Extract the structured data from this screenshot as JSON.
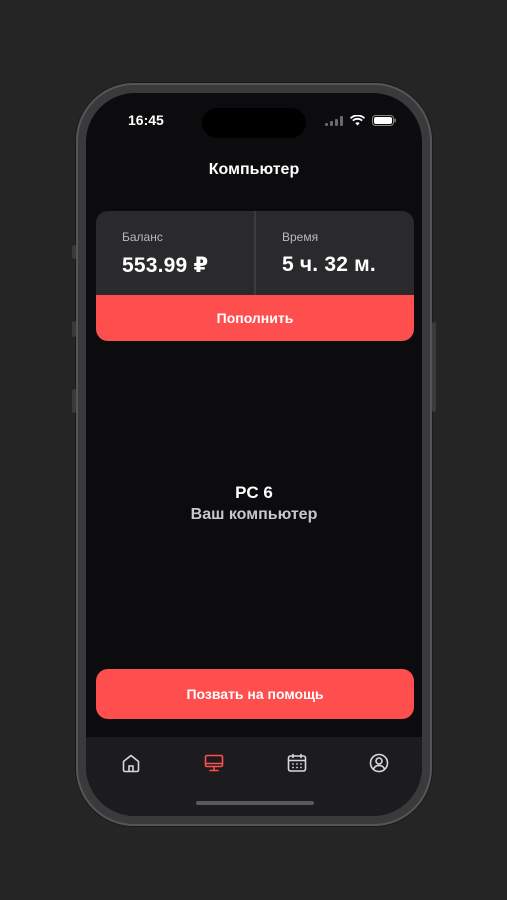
{
  "status_bar": {
    "time": "16:45"
  },
  "header": {
    "title": "Компьютер"
  },
  "balance_card": {
    "balance_label": "Баланс",
    "balance_value": "553.99 ₽",
    "time_label": "Время",
    "time_value": "5 ч. 32 м.",
    "topup_label": "Пополнить"
  },
  "pc": {
    "name": "PC 6",
    "subtitle": "Ваш компьютер"
  },
  "help_button": {
    "label": "Позвать на помощь"
  },
  "tabbar": {
    "tabs": [
      {
        "icon": "home-icon",
        "active": false
      },
      {
        "icon": "computer-icon",
        "active": true
      },
      {
        "icon": "calendar-icon",
        "active": false
      },
      {
        "icon": "profile-icon",
        "active": false
      }
    ]
  },
  "colors": {
    "accent": "#ff4e4e",
    "background": "#0c0c0e",
    "card": "#2a2a2c"
  }
}
